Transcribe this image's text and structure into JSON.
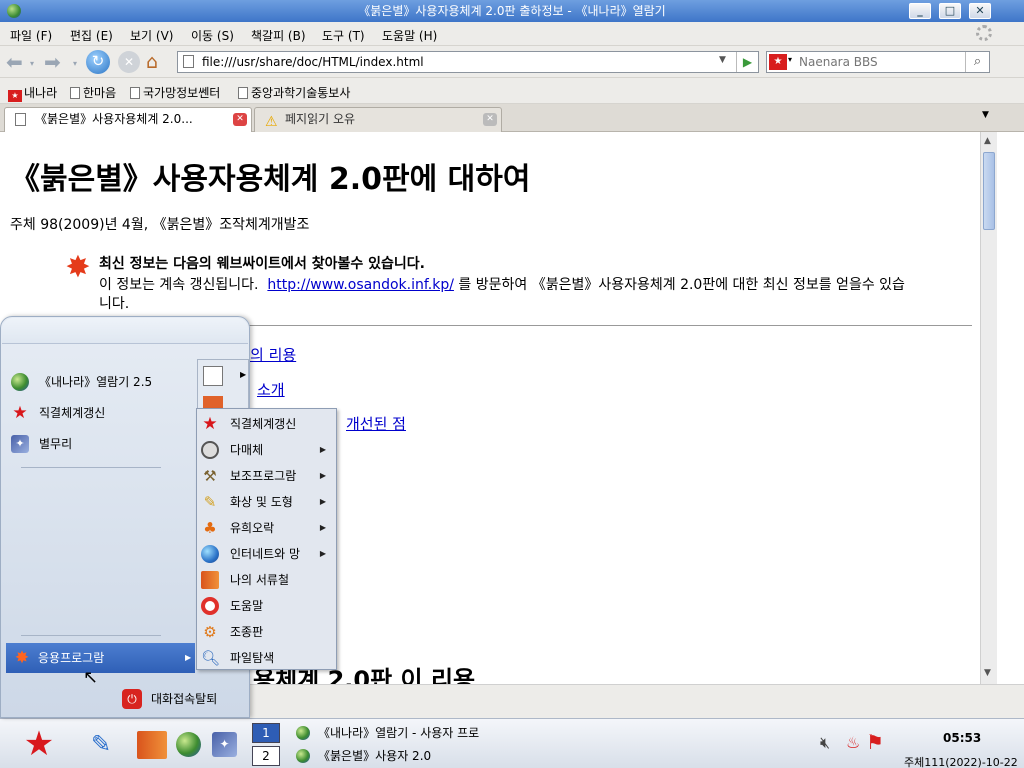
{
  "window": {
    "title": "《붉은별》사용자용체계 2.0판 출하정보 - 《내나라》열람기",
    "buttons": {
      "minimize": "_",
      "maximize": "□",
      "close": "✕"
    }
  },
  "menubar": [
    "파일 (F)",
    "편집 (E)",
    "보기 (V)",
    "이동 (S)",
    "책갈피 (B)",
    "도구 (T)",
    "도움말 (H)"
  ],
  "navbar": {
    "url": "file:///usr/share/doc/HTML/index.html",
    "search_placeholder": "Naenara BBS"
  },
  "bookmarks": [
    "내나라",
    "한마음",
    "국가망정보쎈터",
    "중앙과학기술통보사"
  ],
  "tabs": [
    {
      "label": "《붉은별》사용자용체계 2.0...",
      "active": true
    },
    {
      "label": "페지읽기 오유",
      "active": false
    }
  ],
  "page": {
    "heading": "《붉은별》사용자용체계 2.0판에 대하여",
    "byline": "주체 98(2009)년 4월, 《붉은별》조작체계개발조",
    "info_title": "최신 정보는 다음의 웨브싸이트에서 찾아볼수 있습니다.",
    "info_text_before": "이 정보는 계속 갱신됩니다.",
    "info_link": "http://www.osandok.inf.kp/",
    "info_text_after": "를 방문하여 《붉은별》사용자용체계 2.0판에 대한 최신 정보를 얻을수 있습니다.",
    "link1": "의 리용",
    "link2": "소개",
    "link3": "개선된 점",
    "bottom_heading": "용체계 2.0판 이 리용"
  },
  "start_menu": {
    "favorites": [
      {
        "label": "《내나라》열람기 2.5",
        "icon": "globe-icon"
      },
      {
        "label": "직결체계갱신",
        "icon": "red-star-icon"
      },
      {
        "label": "별무리",
        "icon": "star-cluster-icon"
      }
    ],
    "applications_label": "응용프로그람",
    "logout_label": "대화접속탈퇴"
  },
  "submenu": [
    {
      "label": "직결체계갱신",
      "icon": "red-star-icon",
      "arrow": false
    },
    {
      "label": "다매체",
      "icon": "multimedia-icon",
      "arrow": true
    },
    {
      "label": "보조프로그람",
      "icon": "tools-icon",
      "arrow": true
    },
    {
      "label": "화상 및 도형",
      "icon": "graphics-icon",
      "arrow": true
    },
    {
      "label": "유희오락",
      "icon": "games-icon",
      "arrow": true
    },
    {
      "label": "인터네트와 망",
      "icon": "network-globe-icon",
      "arrow": true
    },
    {
      "label": "나의 서류철",
      "icon": "folder-icon",
      "arrow": false
    },
    {
      "label": "도움말",
      "icon": "help-lifebuoy-icon",
      "arrow": false
    },
    {
      "label": "조종판",
      "icon": "control-panel-icon",
      "arrow": false
    },
    {
      "label": "파일탐색",
      "icon": "file-search-icon",
      "arrow": false
    }
  ],
  "taskbar": {
    "workspaces": [
      "1",
      "2"
    ],
    "tasks": [
      "《내나라》열람기 - 사용자 프로",
      "《붉은별》사용자 2.0"
    ],
    "clock": "05:53",
    "date": "주체111(2022)-10-22"
  }
}
